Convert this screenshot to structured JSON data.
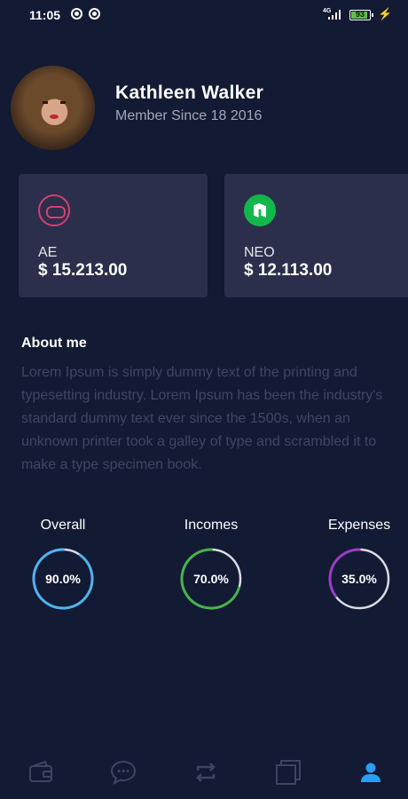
{
  "status_bar": {
    "time": "11:05",
    "network": "4G",
    "battery": "93",
    "battery_level": 0.93
  },
  "profile": {
    "name": "Kathleen Walker",
    "since": "Member Since 18 2016"
  },
  "coins": [
    {
      "symbol": "AE",
      "value": "$ 15.213.00",
      "color": "#d33f73",
      "icon": "aeternity-icon"
    },
    {
      "symbol": "NEO",
      "value": "$ 12.113.00",
      "color": "#12b74b",
      "icon": "neo-icon"
    }
  ],
  "about": {
    "title": "About me",
    "text": "Lorem Ipsum is simply dummy text of the printing and typesetting industry. Lorem Ipsum has been the industry's standard dummy text ever since the 1500s, when an unknown printer took a galley of type and scrambled it to make a type specimen book."
  },
  "stats": [
    {
      "label": "Overall",
      "value": "90.0%",
      "percent": 90,
      "color": "#4fb3f1"
    },
    {
      "label": "Incomes",
      "value": "70.0%",
      "percent": 70,
      "color": "#43b54a"
    },
    {
      "label": "Expenses",
      "value": "35.0%",
      "percent": 35,
      "color": "#9a3cc2"
    }
  ],
  "bottom_nav": {
    "items": [
      "wallet-icon",
      "chat-icon",
      "exchange-icon",
      "cards-icon",
      "profile-icon"
    ],
    "active": "profile-icon",
    "active_color": "#2a9df4",
    "inactive_color": "#3d4563"
  }
}
